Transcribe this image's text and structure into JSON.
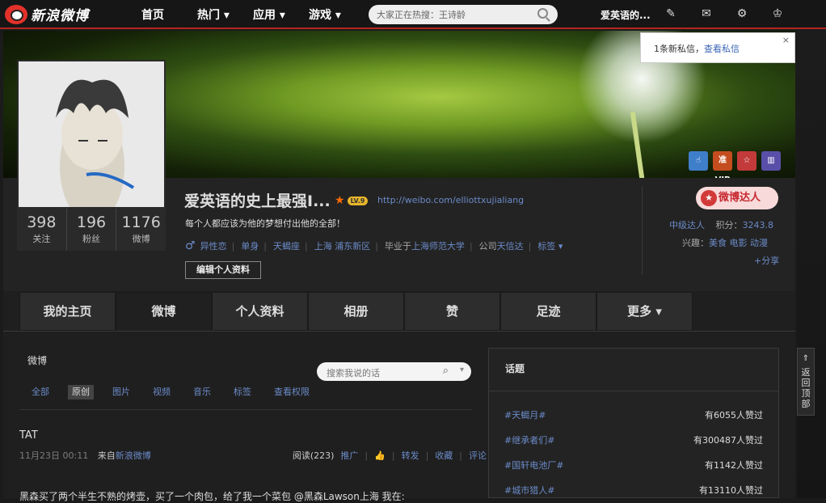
{
  "topbar": {
    "logo_text": "新浪微博",
    "nav": [
      "首页",
      "热门 ▾",
      "应用 ▾",
      "游戏 ▾"
    ],
    "search_placeholder": "大家正在热搜：王诗龄",
    "user_name": "爱英语的...",
    "icons": [
      "edit-icon",
      "message-icon",
      "gear-icon",
      "crown-icon"
    ]
  },
  "notify": {
    "text": "1条新私信，",
    "link": "查看私信",
    "close": "×"
  },
  "badges": [
    "hand-badge",
    "准VIP",
    "star-badge",
    "chart-badge"
  ],
  "profile": {
    "name": "爱英语的史上最强I...",
    "level": "LV.9",
    "url": "http://weibo.com/elliottxujialiang",
    "motto": "每个人都应该为他的梦想付出他的全部！",
    "gender_icon": "♂",
    "orientation": "异性恋",
    "status": "单身",
    "sign": "天蝎座",
    "location": "上海 浦东新区",
    "school_prefix": "毕业于",
    "school": "上海师范大学",
    "company_prefix": "公司",
    "company": "天信达",
    "tags_label": "标签 ▾",
    "edit_button": "编辑个人资料",
    "stats": [
      {
        "num": "398",
        "label": "关注"
      },
      {
        "num": "196",
        "label": "粉丝"
      },
      {
        "num": "1176",
        "label": "微博"
      }
    ]
  },
  "right_info": {
    "expert_label": "微博达人",
    "level": "中级达人",
    "points_label": "积分：",
    "points": "3243.8",
    "interest_label": "兴趣：",
    "interests": "美食 电影 动漫",
    "share": "+分享"
  },
  "tabs": [
    "我的主页",
    "微博",
    "个人资料",
    "相册",
    "赞",
    "足迹",
    "更多 ▾"
  ],
  "feed": {
    "title": "微博",
    "search_placeholder": "搜索我说的话",
    "filters": [
      "全部",
      "原创",
      "图片",
      "视频",
      "音乐",
      "标签",
      "查看权限"
    ],
    "post": {
      "name": "TAT",
      "time": "11月23日 00:11",
      "source_prefix": "来自",
      "source": "新浪微博",
      "reads": "阅读(223)",
      "promote": "推广",
      "forward": "转发",
      "favorite": "收藏",
      "comment": "评论",
      "text": "黑森买了两个半生不熟的烤壶，买了一个肉包，给了我一个菜包 @黑森Lawson上海 我在:"
    }
  },
  "topics": {
    "title": "话题",
    "items": [
      {
        "name": "#天蝎月#",
        "count": "有6055人赞过"
      },
      {
        "name": "#继承者们#",
        "count": "有300487人赞过"
      },
      {
        "name": "#国轩电池厂#",
        "count": "有1142人赞过"
      },
      {
        "name": "#城市猎人#",
        "count": "有13110人赞过"
      }
    ]
  },
  "backtop": "返回顶部"
}
